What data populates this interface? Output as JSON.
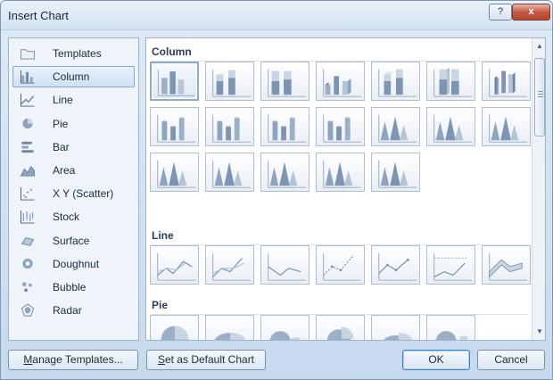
{
  "window": {
    "title": "Insert Chart",
    "help_label": "?",
    "close_label": "x"
  },
  "categories": [
    {
      "label": "Templates",
      "icon": "folder-icon",
      "selected": false
    },
    {
      "label": "Column",
      "icon": "column-chart-icon",
      "selected": true
    },
    {
      "label": "Line",
      "icon": "line-chart-icon",
      "selected": false
    },
    {
      "label": "Pie",
      "icon": "pie-chart-icon",
      "selected": false
    },
    {
      "label": "Bar",
      "icon": "bar-chart-icon",
      "selected": false
    },
    {
      "label": "Area",
      "icon": "area-chart-icon",
      "selected": false
    },
    {
      "label": "X Y (Scatter)",
      "icon": "scatter-chart-icon",
      "selected": false
    },
    {
      "label": "Stock",
      "icon": "stock-chart-icon",
      "selected": false
    },
    {
      "label": "Surface",
      "icon": "surface-chart-icon",
      "selected": false
    },
    {
      "label": "Doughnut",
      "icon": "doughnut-chart-icon",
      "selected": false
    },
    {
      "label": "Bubble",
      "icon": "bubble-chart-icon",
      "selected": false
    },
    {
      "label": "Radar",
      "icon": "radar-chart-icon",
      "selected": false
    }
  ],
  "gallery": {
    "sections": [
      {
        "label": "Column",
        "count": 19,
        "kind": "column"
      },
      {
        "label": "Line",
        "count": 7,
        "kind": "line"
      },
      {
        "label": "Pie",
        "count": 6,
        "kind": "pie"
      }
    ],
    "selected_thumb": "column-0"
  },
  "buttons": {
    "manage_templates_mnemonic": "M",
    "manage_templates_rest": "anage Templates...",
    "set_default_mnemonic": "S",
    "set_default_rest": "et as Default Chart",
    "ok": "OK",
    "cancel": "Cancel"
  },
  "colors": {
    "dialog_bg": "#cfe0f1",
    "accent_blue": "#4f81bd",
    "accent_red": "#c0504d",
    "accent_green": "#9bbb59"
  }
}
